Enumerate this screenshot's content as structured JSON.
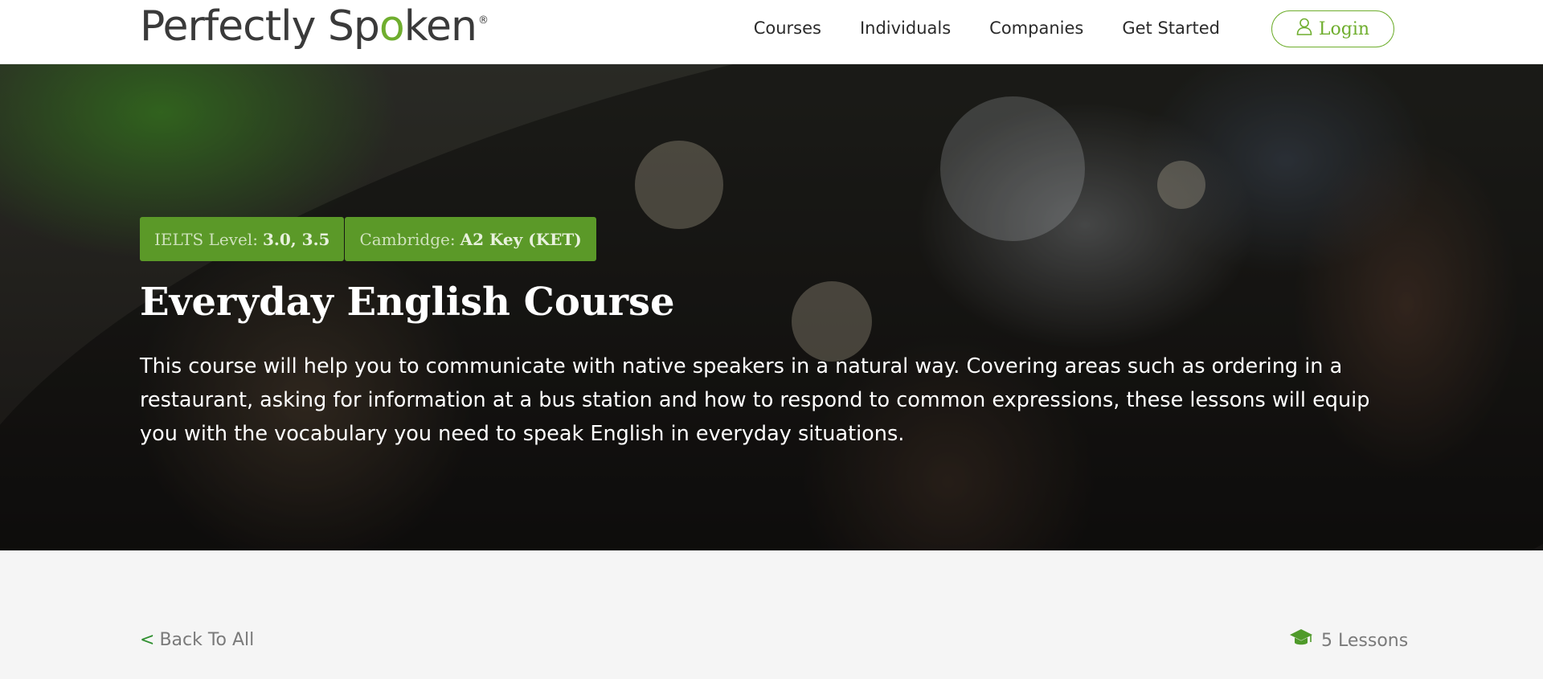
{
  "header": {
    "logo_text_before": "Perfectly Sp",
    "logo_o": "o",
    "logo_text_after": "ken",
    "logo_reg": "®",
    "nav": [
      {
        "label": "Courses"
      },
      {
        "label": "Individuals"
      },
      {
        "label": "Companies"
      },
      {
        "label": "Get Started"
      }
    ],
    "login_label": "Login",
    "login_icon": "user-icon"
  },
  "hero": {
    "badges": [
      {
        "label": "IELTS Level:",
        "value": "3.0, 3.5"
      },
      {
        "label": "Cambridge:",
        "value": "A2 Key (KET)"
      }
    ],
    "title": "Everyday English Course",
    "description": "This course will help you to communicate with native speakers in a natural way. Covering areas such as ordering in a restaurant, asking for information at a bus station and how to respond to common expressions, these lessons will equip you with the vocabulary you need to speak English in everyday situations."
  },
  "footer_bar": {
    "back_chevron": "<",
    "back_label": "Back To All",
    "lessons_icon": "graduation-cap-icon",
    "lessons_label": "5 Lessons"
  },
  "colors": {
    "brand_green": "#6fae2e",
    "badge_green": "#5b9928",
    "header_bg": "#ffffff",
    "page_bg": "#f5f5f5"
  }
}
